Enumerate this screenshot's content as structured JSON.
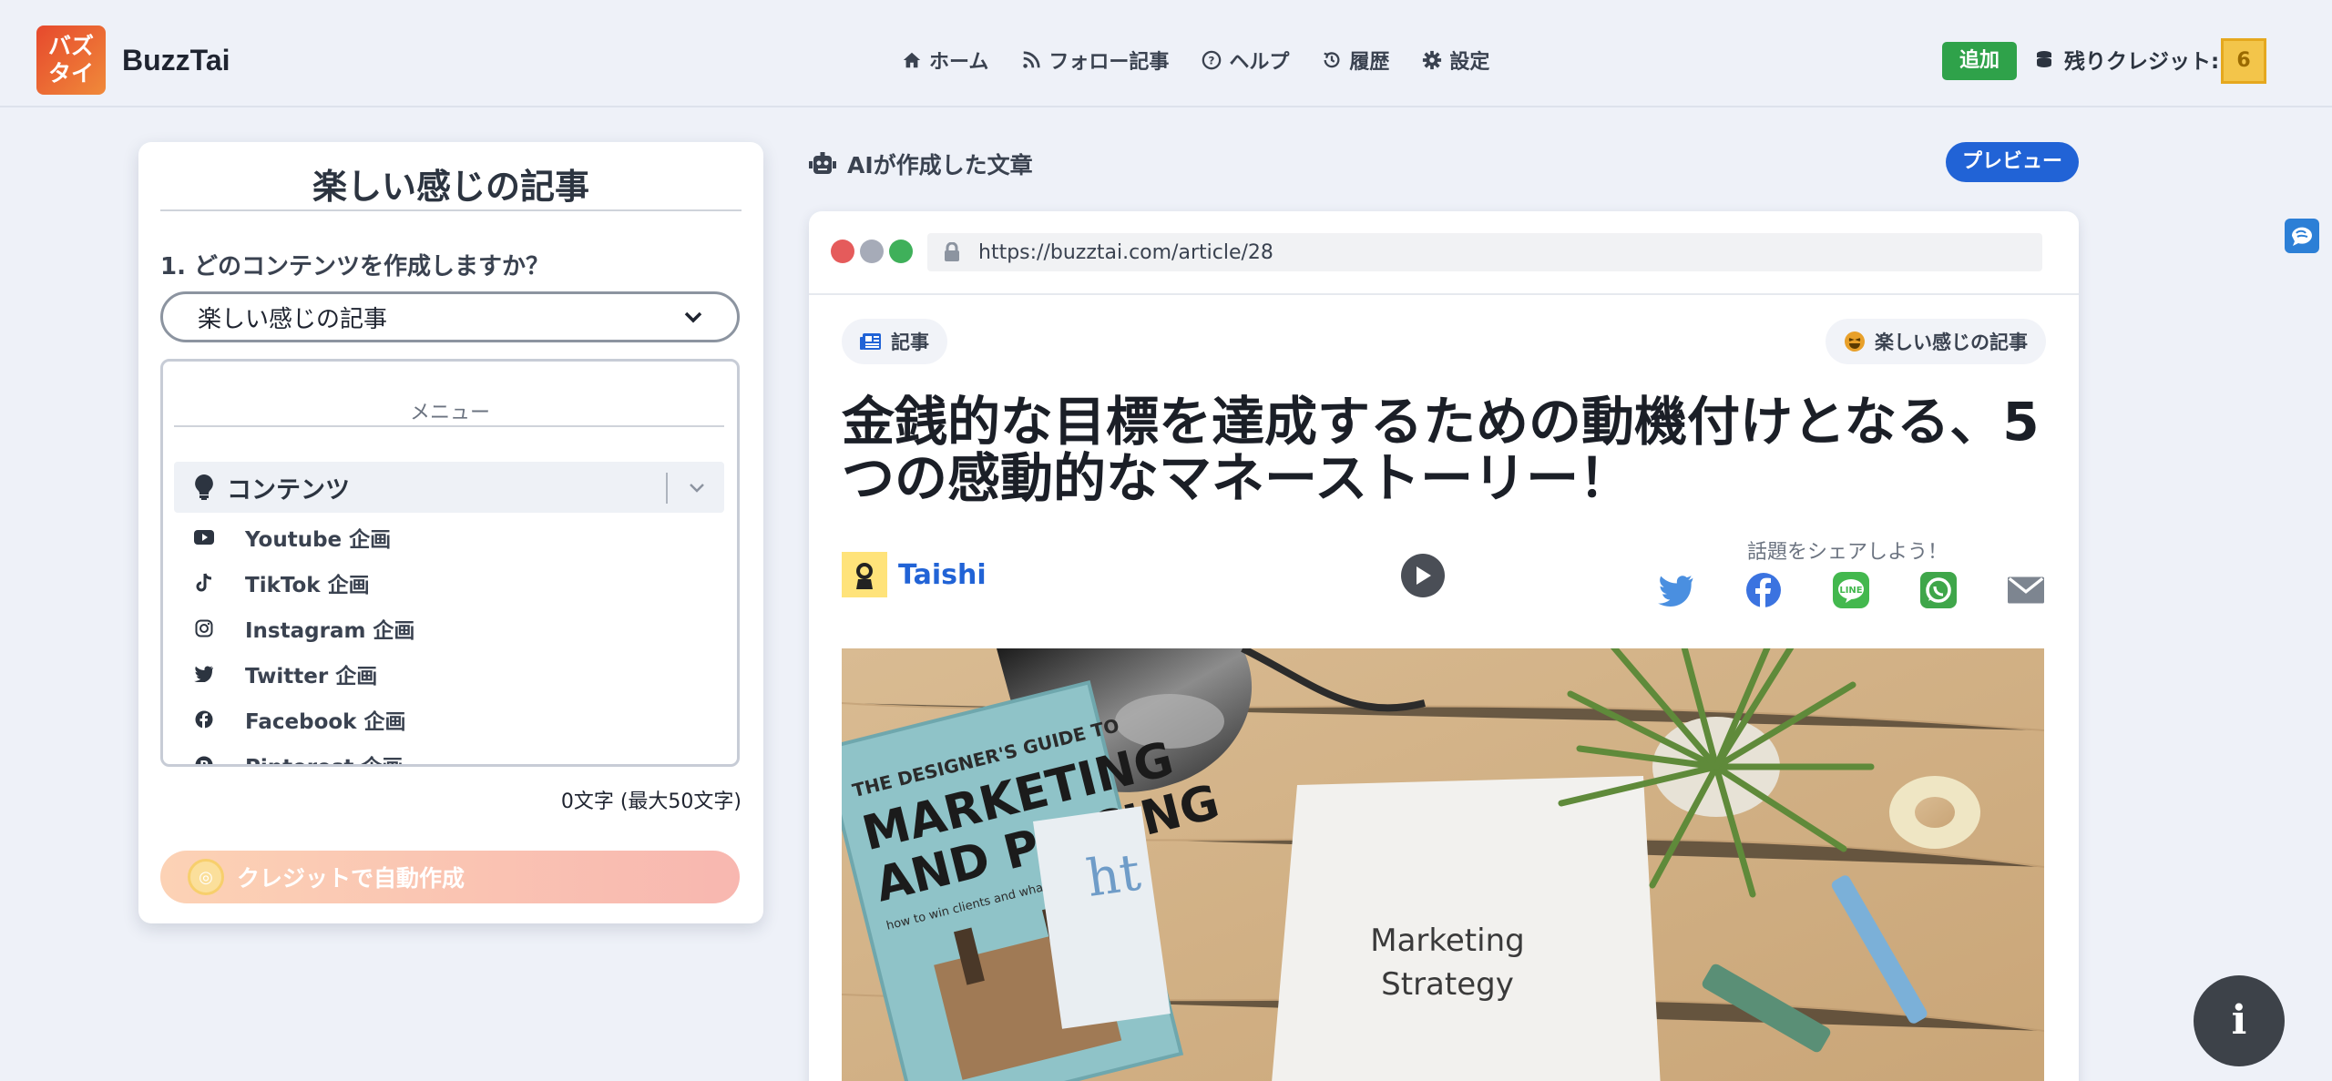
{
  "header": {
    "logo_line1": "バズ",
    "logo_line2": "タイ",
    "brand": "BuzzTai",
    "nav": [
      {
        "label": "ホーム",
        "icon": "home-icon"
      },
      {
        "label": "フォロー記事",
        "icon": "rss-icon"
      },
      {
        "label": "ヘルプ",
        "icon": "help-icon"
      },
      {
        "label": "履歴",
        "icon": "history-icon"
      },
      {
        "label": "設定",
        "icon": "gear-icon"
      }
    ],
    "add_label": "追加",
    "credits_label": "残りクレジット:",
    "credits_value": "6"
  },
  "left": {
    "title": "楽しい感じの記事",
    "question": "1. どのコンテンツを作成しますか？",
    "select_value": "楽しい感じの記事",
    "menu_header": "メニュー",
    "menu_group": "コンテンツ",
    "menu_items": [
      {
        "label": "Youtube 企画",
        "icon": "youtube-icon"
      },
      {
        "label": "TikTok 企画",
        "icon": "tiktok-icon"
      },
      {
        "label": "Instagram 企画",
        "icon": "instagram-icon"
      },
      {
        "label": "Twitter 企画",
        "icon": "twitter-icon"
      },
      {
        "label": "Facebook 企画",
        "icon": "facebook-icon"
      },
      {
        "label": "Pinterest 企画",
        "icon": "pinterest-icon"
      }
    ],
    "char_count": "0文字 (最大50文字)",
    "auto_button": "クレジットで自動作成"
  },
  "right": {
    "ai_label": "AIが作成した文章",
    "preview_label": "プレビュー",
    "url": "https://buzztai.com/article/28",
    "chip_article": "記事",
    "chip_category": "楽しい感じの記事",
    "headline": "金銭的な目標を達成するための動機付けとなる、5つの感動的なマネーストーリー！",
    "author": "Taishi",
    "share_text": "話題をシェアしよう！",
    "hero": {
      "book_line1": "THE DESIGNER'S GUIDE TO",
      "book_line2": "MARKETING",
      "book_line3": "AND PRICING",
      "book_sub": "how to win clients and what to charge them",
      "paper_line1": "Marketing",
      "paper_line2": "Strategy",
      "card_text": "ht"
    }
  },
  "floating": {
    "info_label": "i"
  },
  "colors": {
    "accent_blue": "#2163d6",
    "add_green": "#2fa24a",
    "credit_gold": "#f3c54a",
    "logo_orange": "#e6492d"
  }
}
